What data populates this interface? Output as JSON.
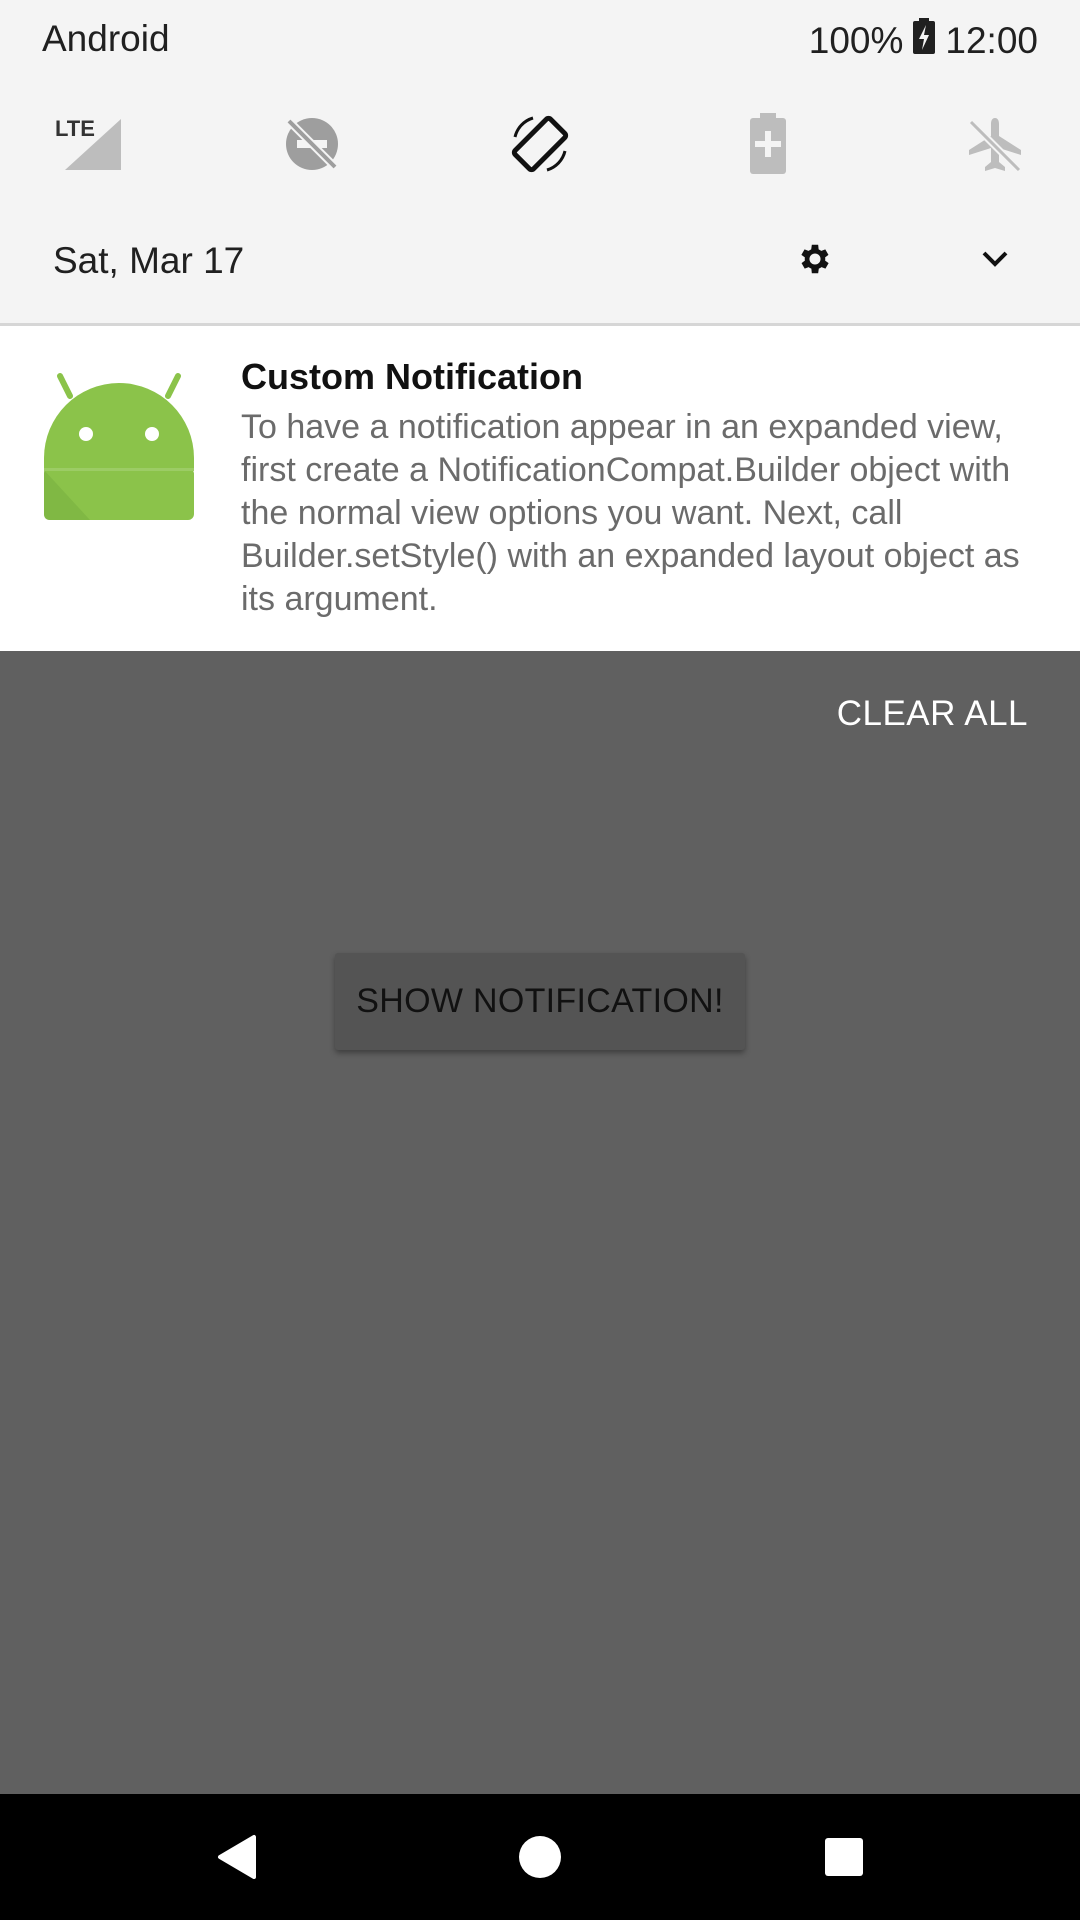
{
  "status_bar": {
    "carrier": "Android",
    "battery": "100%",
    "time": "12:00"
  },
  "quick_settings": {
    "tiles": [
      {
        "icon": "lte-signal-icon",
        "label": "LTE"
      },
      {
        "icon": "do-not-disturb-off-icon"
      },
      {
        "icon": "auto-rotate-icon"
      },
      {
        "icon": "battery-saver-icon"
      },
      {
        "icon": "airplane-mode-off-icon"
      }
    ],
    "date": "Sat, Mar 17",
    "settings_icon": "gear-icon",
    "expand_icon": "chevron-down-icon"
  },
  "notification": {
    "icon": "android-robot-icon",
    "title": "Custom Notification",
    "body": "To have a notification appear in an expanded view, first create a NotificationCompat.Builder object with the normal view options you want. Next, call Builder.setStyle() with an expanded layout object as its argument."
  },
  "clear_all_label": "CLEAR ALL",
  "app": {
    "button_label": "SHOW NOTIFICATION!"
  },
  "nav_bar": {
    "back_icon": "back-triangle-icon",
    "home_icon": "home-circle-icon",
    "recents_icon": "recents-square-icon"
  },
  "colors": {
    "shade_bg": "#f4f4f4",
    "scrim_bg": "#606060",
    "android_green": "#8bc34a",
    "nav_bg": "#000000"
  }
}
